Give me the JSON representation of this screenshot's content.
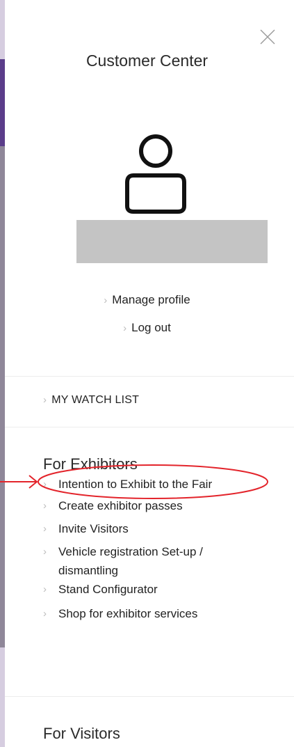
{
  "header": {
    "title": "Customer Center",
    "close_icon": "close-icon"
  },
  "profile": {
    "avatar_icon": "user-avatar-icon",
    "links": [
      {
        "label": "Manage profile"
      },
      {
        "label": "Log out"
      }
    ]
  },
  "watchlist": {
    "label": "MY WATCH LIST"
  },
  "exhibitors": {
    "title": "For Exhibitors",
    "items": [
      {
        "label": "Intention to Exhibit to the Fair"
      },
      {
        "label": "Create exhibitor passes"
      },
      {
        "label": "Invite Visitors"
      },
      {
        "label": "Vehicle registration Set-up / dismantling"
      },
      {
        "label": "Stand Configurator"
      },
      {
        "label": "Shop for exhibitor services"
      }
    ]
  },
  "visitors": {
    "title": "For Visitors"
  },
  "chevron": "›",
  "colors": {
    "accent": "#5b3d8a",
    "annotation": "#e3242b",
    "placeholder": "#c4c4c4"
  }
}
